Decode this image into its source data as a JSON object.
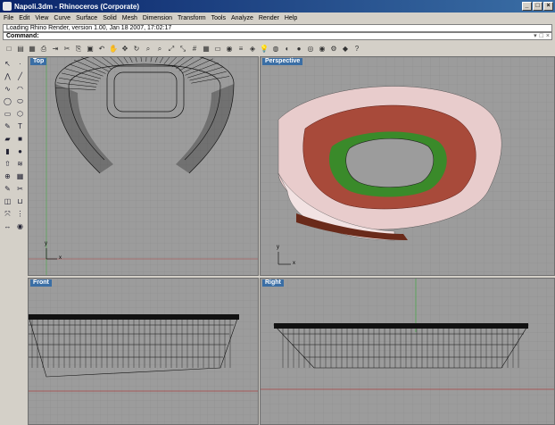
{
  "window": {
    "title": "Napoli.3dm - Rhinoceros (Corporate)"
  },
  "menu": [
    "File",
    "Edit",
    "View",
    "Curve",
    "Surface",
    "Solid",
    "Mesh",
    "Dimension",
    "Transform",
    "Tools",
    "Analyze",
    "Render",
    "Help"
  ],
  "history": {
    "text": "Loading Rhino Render, version 1.00, Jan 18 2007, 17:02:17"
  },
  "command": {
    "label": "Command:"
  },
  "viewports": {
    "top": {
      "label": "Top"
    },
    "perspective": {
      "label": "Perspective"
    },
    "front": {
      "label": "Front"
    },
    "right": {
      "label": "Right"
    }
  },
  "axes": {
    "x": "x",
    "y": "y"
  },
  "toolbar_icons": [
    "new-icon",
    "open-icon",
    "save-icon",
    "print-icon",
    "import-icon",
    "cut-icon",
    "copy-icon",
    "paste-icon",
    "undo-icon",
    "hand-icon",
    "pan-icon",
    "rotate-icon",
    "zoom-icon",
    "zoom-window-icon",
    "zoom-extents-icon",
    "zoom-selected-icon",
    "grid-icon",
    "4view-icon",
    "plan-icon",
    "camera-icon",
    "layer-icon",
    "properties-icon",
    "lightbulb-icon",
    "material-icon",
    "color-icon",
    "sphere-icon",
    "render-icon",
    "globe-icon",
    "option-icon",
    "osnap-icon",
    "help-icon"
  ],
  "sidebar_icons": [
    "select-icon",
    "point-icon",
    "polyline-icon",
    "line-icon",
    "curve-icon",
    "arc-icon",
    "circle-icon",
    "ellipse-icon",
    "rectangle-icon",
    "polygon-icon",
    "freeform-icon",
    "text-icon",
    "surface-icon",
    "box-icon",
    "cylinder-icon",
    "sphere-icon",
    "extrude-icon",
    "loft-icon",
    "boolean-icon",
    "mesh-icon",
    "edit-icon",
    "trim-icon",
    "split-icon",
    "join-icon",
    "transform-icon",
    "array-icon",
    "dim-icon",
    "render-icon"
  ]
}
